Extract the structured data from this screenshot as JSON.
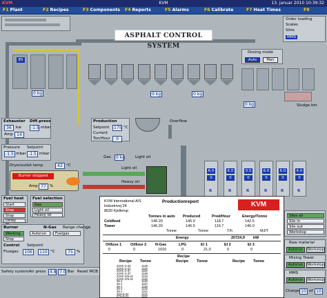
{
  "titlebar": {
    "left": "KVM",
    "center": "KVM",
    "right": "13. januar 2010  10:39:32"
  },
  "menu": [
    {
      "key": "F1",
      "label": "Plant"
    },
    {
      "key": "F2",
      "label": "Recipes"
    },
    {
      "key": "F3",
      "label": "Components"
    },
    {
      "key": "F4",
      "label": "Reports"
    },
    {
      "key": "F5",
      "label": "Alarms"
    },
    {
      "key": "F6",
      "label": "Calibrate"
    },
    {
      "key": "F7",
      "label": "Heat Times"
    },
    {
      "key": "F8",
      "label": ""
    }
  ],
  "banner": "ASPHALT CONTROL SYSTEM",
  "side_box": {
    "l1": "Order loading",
    "l2": "Scales",
    "l3": "Silos",
    "l4": "MMS"
  },
  "dosing": {
    "title": "Dosing mode",
    "auto": "Auto",
    "man": "Man"
  },
  "exhauster": {
    "title": "Exhauster",
    "kw_val": "36",
    "kw_unit": "kw",
    "amp_label": "Amp",
    "amp_val": "14",
    "diffpress_title": "Diff.press",
    "diffpress_val": "-1.5",
    "diffpress_unit": "mbar"
  },
  "pressure": {
    "label": "Pressure",
    "val": "-1.5",
    "unit": "mbar",
    "setpoint_label": "Setpoint",
    "setpoint_val": "-1.5",
    "setpoint_unit": "mbar"
  },
  "dryer": {
    "label": "Dryeroutlet temp.",
    "val": "42",
    "unit": "°C",
    "burner": "Burner stopped",
    "amp_label": "Amp",
    "amp_val": "77",
    "amp_unit": "%"
  },
  "production": {
    "title": "Production",
    "setpoint": "Setpoint",
    "setpoint_val": "175",
    "unit": "°C",
    "current": "Current",
    "current_val": "",
    "tonhour": "Ton/Hour",
    "tonhour_val": "0"
  },
  "overflow": "Overflow",
  "sludge": "Sludge bin",
  "kg_zero": "0 kg",
  "gas": {
    "label": "Gas",
    "light_oil": "Light oil",
    "light_oil_2": "Light oil",
    "heavy_oil": "Heavy oil"
  },
  "fuel_heat": {
    "title": "Fuel heat",
    "items": [
      "Start",
      "Stop",
      "Stop",
      "Delay"
    ]
  },
  "fuel_select": {
    "title": "Fuel selection",
    "items": [
      "Gas",
      "Light oil",
      "Heavy oil"
    ]
  },
  "ngas": {
    "title": "N-Gas",
    "range_title": "Range change"
  },
  "burner": {
    "title": "Burner",
    "working": "Working",
    "stop": "Stop",
    "autorun": "Autorun",
    "fuelgas": "Fuelgas"
  },
  "control": {
    "title": "Control",
    "setpoint": "Setpoint",
    "fluegas": "Fluegas",
    "fluegas_val": "106",
    "fluegas_sp": "110",
    "deg": "°C",
    "pct_val": "75",
    "pct_unit": "%"
  },
  "status": {
    "safety": "Safety system",
    "air_press": "Air press",
    "air_val": "4.8",
    "air_val2": "7.0",
    "bar": "Bar",
    "reset": "Reset MCB"
  },
  "tanks": [
    {
      "val": "6.0",
      "sp": "0",
      "letter": "R"
    },
    {
      "val": "6.0",
      "sp": "0",
      "letter": "R"
    },
    {
      "val": "0.0",
      "sp": "0",
      "letter": "R"
    },
    {
      "val": "6.0",
      "sp": "0",
      "letter": "R"
    },
    {
      "val": "6.0",
      "sp": "0",
      "letter": "R"
    },
    {
      "val": "6.0",
      "sp": "0",
      "letter": "R"
    }
  ],
  "right_legend": {
    "items": [
      "Silos all",
      "Silo in",
      "Silo out",
      "Workstop"
    ]
  },
  "raw_material": {
    "title": "Raw material",
    "autorun": "Autorun",
    "workstop": "Workstop"
  },
  "mixing_tower": {
    "title": "Mixing Tower",
    "autorun": "Autorun",
    "workstop": "Workstop"
  },
  "mms": {
    "title": "MMS",
    "autorun": "Autorun",
    "workstop": "Workstop"
  },
  "charge": {
    "label": "Charge",
    "val": "10",
    "of": "of",
    "total": "10"
  },
  "report": {
    "company": "KVM International A/S",
    "street": "Industrivej 24",
    "city": "8620 Kjellerup",
    "heading": "Productionreport",
    "logo": "KVM",
    "cols": [
      "Tonnes in auto",
      "Produced",
      "Prod/Hour",
      "Energy/Tonne"
    ],
    "coldfeed": "Coldfeed",
    "tower": "Tower",
    "cf_vals": [
      "146.20",
      "145.0",
      "118.7",
      "142.5"
    ],
    "tw_vals": [
      "146.20",
      "146.5",
      "116.7",
      "146.0"
    ],
    "units": [
      "Tonne",
      "Tonne",
      "T/h",
      "MJ/T"
    ],
    "energy_title": "Energy",
    "energy_val": "20724,9",
    "energy_unit": "kW",
    "fuel_cols": [
      "Oilfuse 1",
      "Oilfuse 2",
      "N-Gas",
      "LPG",
      "El 1",
      "El 2",
      "El 3"
    ],
    "fuel_vals": [
      "0",
      "0",
      "1010",
      "0",
      "21,0",
      "0",
      "0"
    ],
    "recipe_title": "Recipe",
    "recipe_cols": [
      "Recipe",
      "Tonne",
      "Recipe",
      "Tonne",
      "Recipe",
      "Tonne"
    ],
    "recipes": [
      [
        "22HC-2-22",
        "1125"
      ],
      [
        "22HC-2-27",
        "1119"
      ],
      [
        "22HC-2-37",
        "1118"
      ],
      [
        "22HC-2-37",
        "1126"
      ],
      [
        "22HC-2/6-41",
        "1134"
      ],
      [
        "22HC-2/5-41",
        "1118"
      ],
      [
        "25-1",
        "1120"
      ],
      [
        "25-1",
        "1110"
      ],
      [
        "25-1",
        "1118"
      ],
      [
        "25-1",
        "1132"
      ],
      [
        "25-1",
        "1114"
      ],
      [
        "26H-5-24",
        "1121"
      ],
      [
        "27H-5-21",
        "1112"
      ]
    ]
  },
  "bins": [
    "85",
    "",
    "",
    "",
    "",
    "",
    "",
    "",
    "",
    "",
    "",
    "",
    ""
  ]
}
